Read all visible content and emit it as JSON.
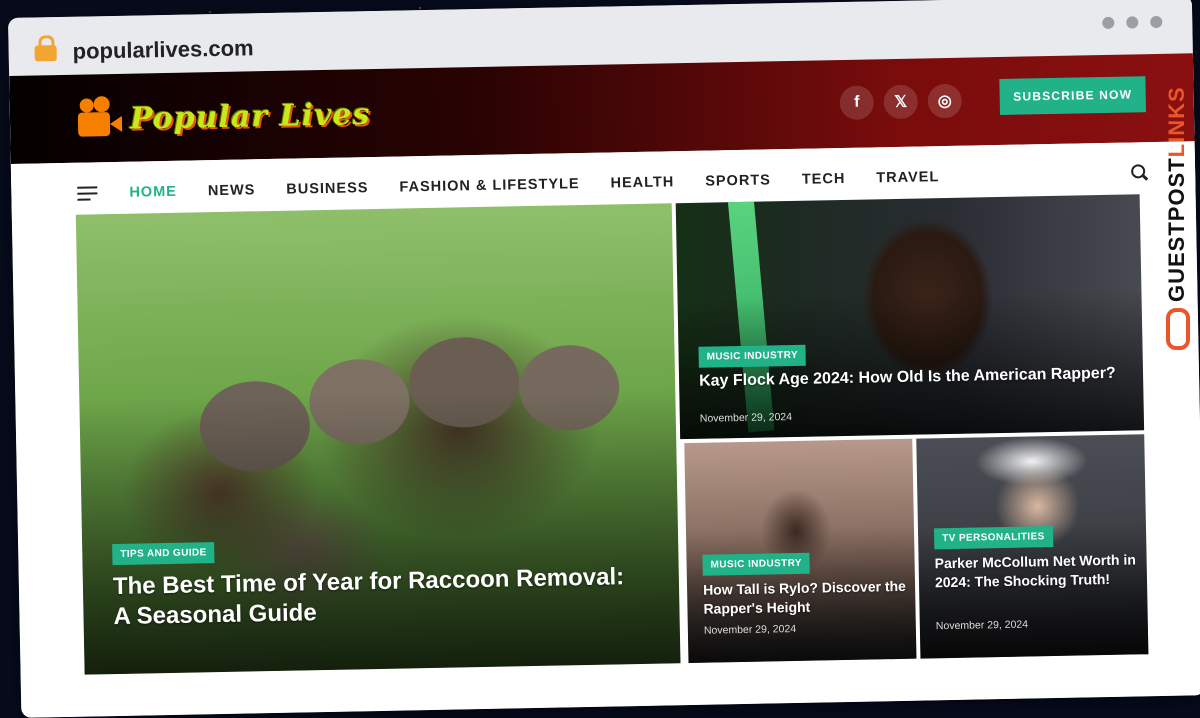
{
  "browser": {
    "url": "popularlives.com"
  },
  "header": {
    "logo_text": "Popular Lives",
    "social": [
      {
        "icon": "facebook-icon",
        "glyph": "f"
      },
      {
        "icon": "x-icon",
        "glyph": "𝕏"
      },
      {
        "icon": "instagram-icon",
        "glyph": "◎"
      }
    ],
    "subscribe_label": "SUBSCRIBE NOW"
  },
  "nav": {
    "items": [
      "HOME",
      "NEWS",
      "BUSINESS",
      "FASHION & LIFESTYLE",
      "HEALTH",
      "SPORTS",
      "TECH",
      "TRAVEL"
    ],
    "active": "HOME"
  },
  "featured": [
    {
      "category": "TIPS AND GUIDE",
      "title": "The Best Time of Year for Raccoon Removal: A Seasonal Guide"
    },
    {
      "category": "MUSIC INDUSTRY",
      "title": "Kay Flock Age 2024: How Old Is the American Rapper?",
      "date": "November 29, 2024"
    },
    {
      "category": "MUSIC INDUSTRY",
      "title": "How Tall is Rylo? Discover the Rapper's Height",
      "date": "November 29, 2024"
    },
    {
      "category": "TV PERSONALITIES",
      "title": "Parker McCollum Net Worth in 2024: The Shocking Truth!",
      "date": "November 29, 2024"
    }
  ],
  "badge": {
    "text_main": "GUESTPOST",
    "text_accent": "LINKS"
  },
  "colors": {
    "accent": "#21b28a",
    "header_dark": "#050000",
    "header_red": "#8a1010",
    "badge_accent": "#e8562a"
  }
}
